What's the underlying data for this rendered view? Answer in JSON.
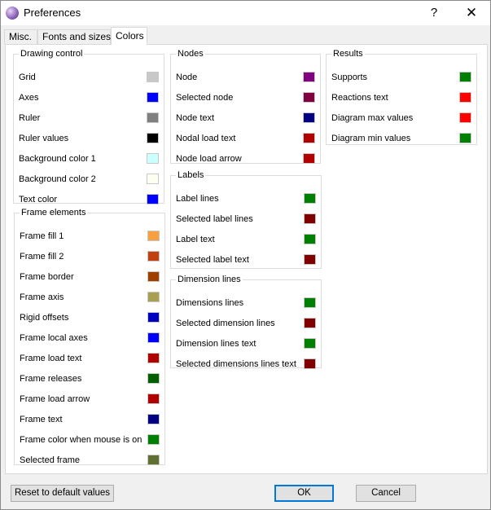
{
  "window": {
    "title": "Preferences",
    "help": "?",
    "close": "✕"
  },
  "tabs": [
    "Misc.",
    "Fonts and sizes",
    "Colors"
  ],
  "groups": {
    "drawing_control": {
      "title": "Drawing control",
      "items": [
        {
          "label": "Grid",
          "color": "#c8c8c8"
        },
        {
          "label": "Axes",
          "color": "#0000ff"
        },
        {
          "label": "Ruler",
          "color": "#808080"
        },
        {
          "label": "Ruler values",
          "color": "#000000"
        },
        {
          "label": "Background color 1",
          "color": "#ccffff"
        },
        {
          "label": "Background color 2",
          "color": "#fdfff0"
        },
        {
          "label": "Text color",
          "color": "#0000ff"
        }
      ]
    },
    "frame_elements": {
      "title": "Frame elements",
      "items": [
        {
          "label": "Frame fill 1",
          "color": "#f8a040"
        },
        {
          "label": "Frame fill 2",
          "color": "#c04010"
        },
        {
          "label": "Frame border",
          "color": "#a04000"
        },
        {
          "label": "Frame axis",
          "color": "#a8a050"
        },
        {
          "label": "Rigid offsets",
          "color": "#0000c0"
        },
        {
          "label": "Frame local axes",
          "color": "#0000ff"
        },
        {
          "label": "Frame load text",
          "color": "#b00000"
        },
        {
          "label": "Frame releases",
          "color": "#006000"
        },
        {
          "label": "Frame load arrow",
          "color": "#b00000"
        },
        {
          "label": "Frame text",
          "color": "#000080"
        },
        {
          "label": "Frame color when mouse is on",
          "color": "#008000"
        },
        {
          "label": "Selected frame",
          "color": "#607030"
        }
      ]
    },
    "nodes": {
      "title": "Nodes",
      "items": [
        {
          "label": "Node",
          "color": "#800080"
        },
        {
          "label": "Selected node",
          "color": "#800040"
        },
        {
          "label": "Node text",
          "color": "#000080"
        },
        {
          "label": "Nodal load text",
          "color": "#b00000"
        },
        {
          "label": "Node load arrow",
          "color": "#b00000"
        }
      ]
    },
    "labels": {
      "title": "Labels",
      "items": [
        {
          "label": "Label lines",
          "color": "#008000"
        },
        {
          "label": "Selected label lines",
          "color": "#800000"
        },
        {
          "label": "Label text",
          "color": "#008000"
        },
        {
          "label": "Selected label text",
          "color": "#800000"
        }
      ]
    },
    "dimension_lines": {
      "title": "Dimension lines",
      "items": [
        {
          "label": "Dimensions lines",
          "color": "#008000"
        },
        {
          "label": "Selected dimension lines",
          "color": "#800000"
        },
        {
          "label": "Dimension lines text",
          "color": "#008000"
        },
        {
          "label": "Selected dimensions lines text",
          "color": "#800000"
        }
      ]
    },
    "results": {
      "title": "Results",
      "items": [
        {
          "label": "Supports",
          "color": "#008000"
        },
        {
          "label": "Reactions text",
          "color": "#ff0000"
        },
        {
          "label": "Diagram max values",
          "color": "#ff0000"
        },
        {
          "label": "Diagram min values",
          "color": "#008000"
        }
      ]
    }
  },
  "buttons": {
    "reset": "Reset to default values",
    "ok": "OK",
    "cancel": "Cancel"
  }
}
